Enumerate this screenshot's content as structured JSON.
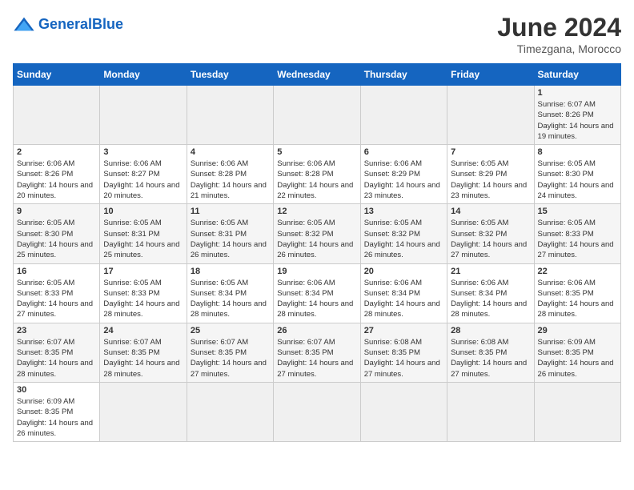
{
  "header": {
    "logo_general": "General",
    "logo_blue": "Blue",
    "month_title": "June 2024",
    "subtitle": "Timezgana, Morocco"
  },
  "weekdays": [
    "Sunday",
    "Monday",
    "Tuesday",
    "Wednesday",
    "Thursday",
    "Friday",
    "Saturday"
  ],
  "weeks": [
    [
      {
        "day": "",
        "info": ""
      },
      {
        "day": "",
        "info": ""
      },
      {
        "day": "",
        "info": ""
      },
      {
        "day": "",
        "info": ""
      },
      {
        "day": "",
        "info": ""
      },
      {
        "day": "",
        "info": ""
      },
      {
        "day": "1",
        "info": "Sunrise: 6:07 AM\nSunset: 8:26 PM\nDaylight: 14 hours and 19 minutes."
      }
    ],
    [
      {
        "day": "2",
        "info": "Sunrise: 6:06 AM\nSunset: 8:26 PM\nDaylight: 14 hours and 20 minutes."
      },
      {
        "day": "3",
        "info": "Sunrise: 6:06 AM\nSunset: 8:27 PM\nDaylight: 14 hours and 20 minutes."
      },
      {
        "day": "4",
        "info": "Sunrise: 6:06 AM\nSunset: 8:28 PM\nDaylight: 14 hours and 21 minutes."
      },
      {
        "day": "5",
        "info": "Sunrise: 6:06 AM\nSunset: 8:28 PM\nDaylight: 14 hours and 22 minutes."
      },
      {
        "day": "6",
        "info": "Sunrise: 6:06 AM\nSunset: 8:29 PM\nDaylight: 14 hours and 23 minutes."
      },
      {
        "day": "7",
        "info": "Sunrise: 6:05 AM\nSunset: 8:29 PM\nDaylight: 14 hours and 23 minutes."
      },
      {
        "day": "8",
        "info": "Sunrise: 6:05 AM\nSunset: 8:30 PM\nDaylight: 14 hours and 24 minutes."
      }
    ],
    [
      {
        "day": "9",
        "info": "Sunrise: 6:05 AM\nSunset: 8:30 PM\nDaylight: 14 hours and 25 minutes."
      },
      {
        "day": "10",
        "info": "Sunrise: 6:05 AM\nSunset: 8:31 PM\nDaylight: 14 hours and 25 minutes."
      },
      {
        "day": "11",
        "info": "Sunrise: 6:05 AM\nSunset: 8:31 PM\nDaylight: 14 hours and 26 minutes."
      },
      {
        "day": "12",
        "info": "Sunrise: 6:05 AM\nSunset: 8:32 PM\nDaylight: 14 hours and 26 minutes."
      },
      {
        "day": "13",
        "info": "Sunrise: 6:05 AM\nSunset: 8:32 PM\nDaylight: 14 hours and 26 minutes."
      },
      {
        "day": "14",
        "info": "Sunrise: 6:05 AM\nSunset: 8:32 PM\nDaylight: 14 hours and 27 minutes."
      },
      {
        "day": "15",
        "info": "Sunrise: 6:05 AM\nSunset: 8:33 PM\nDaylight: 14 hours and 27 minutes."
      }
    ],
    [
      {
        "day": "16",
        "info": "Sunrise: 6:05 AM\nSunset: 8:33 PM\nDaylight: 14 hours and 27 minutes."
      },
      {
        "day": "17",
        "info": "Sunrise: 6:05 AM\nSunset: 8:33 PM\nDaylight: 14 hours and 28 minutes."
      },
      {
        "day": "18",
        "info": "Sunrise: 6:05 AM\nSunset: 8:34 PM\nDaylight: 14 hours and 28 minutes."
      },
      {
        "day": "19",
        "info": "Sunrise: 6:06 AM\nSunset: 8:34 PM\nDaylight: 14 hours and 28 minutes."
      },
      {
        "day": "20",
        "info": "Sunrise: 6:06 AM\nSunset: 8:34 PM\nDaylight: 14 hours and 28 minutes."
      },
      {
        "day": "21",
        "info": "Sunrise: 6:06 AM\nSunset: 8:34 PM\nDaylight: 14 hours and 28 minutes."
      },
      {
        "day": "22",
        "info": "Sunrise: 6:06 AM\nSunset: 8:35 PM\nDaylight: 14 hours and 28 minutes."
      }
    ],
    [
      {
        "day": "23",
        "info": "Sunrise: 6:07 AM\nSunset: 8:35 PM\nDaylight: 14 hours and 28 minutes."
      },
      {
        "day": "24",
        "info": "Sunrise: 6:07 AM\nSunset: 8:35 PM\nDaylight: 14 hours and 28 minutes."
      },
      {
        "day": "25",
        "info": "Sunrise: 6:07 AM\nSunset: 8:35 PM\nDaylight: 14 hours and 27 minutes."
      },
      {
        "day": "26",
        "info": "Sunrise: 6:07 AM\nSunset: 8:35 PM\nDaylight: 14 hours and 27 minutes."
      },
      {
        "day": "27",
        "info": "Sunrise: 6:08 AM\nSunset: 8:35 PM\nDaylight: 14 hours and 27 minutes."
      },
      {
        "day": "28",
        "info": "Sunrise: 6:08 AM\nSunset: 8:35 PM\nDaylight: 14 hours and 27 minutes."
      },
      {
        "day": "29",
        "info": "Sunrise: 6:09 AM\nSunset: 8:35 PM\nDaylight: 14 hours and 26 minutes."
      }
    ],
    [
      {
        "day": "30",
        "info": "Sunrise: 6:09 AM\nSunset: 8:35 PM\nDaylight: 14 hours and 26 minutes."
      },
      {
        "day": "",
        "info": ""
      },
      {
        "day": "",
        "info": ""
      },
      {
        "day": "",
        "info": ""
      },
      {
        "day": "",
        "info": ""
      },
      {
        "day": "",
        "info": ""
      },
      {
        "day": "",
        "info": ""
      }
    ]
  ]
}
